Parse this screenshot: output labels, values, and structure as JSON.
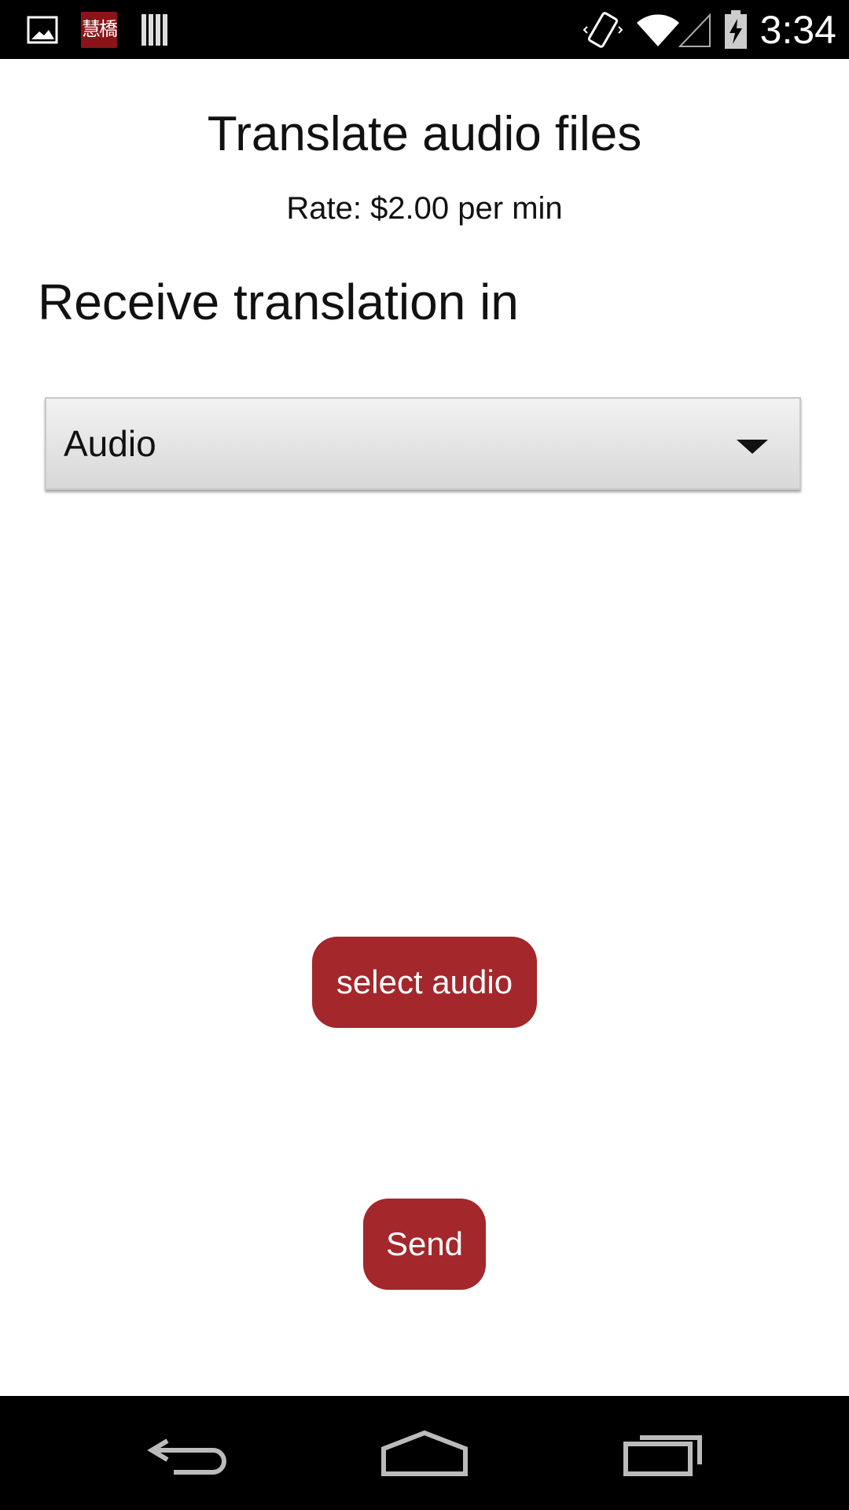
{
  "status_bar": {
    "time": "3:34",
    "app_badge_text": "慧橋",
    "icons": [
      "image-notification-icon",
      "app-notification-icon",
      "library-notification-icon",
      "vibrate-icon",
      "wifi-icon",
      "cell-signal-icon",
      "battery-charging-icon"
    ]
  },
  "main": {
    "title": "Translate audio files",
    "rate": "Rate: $2.00 per min",
    "section_heading": "Receive translation in",
    "format_dropdown": {
      "selected": "Audio"
    },
    "select_audio_label": "select audio",
    "send_label": "Send"
  },
  "colors": {
    "button": "#a3272b",
    "status_bar": "#000000",
    "nav_bar": "#000000"
  },
  "nav_bar": {
    "icons": [
      "back-icon",
      "home-icon",
      "recent-apps-icon"
    ]
  }
}
